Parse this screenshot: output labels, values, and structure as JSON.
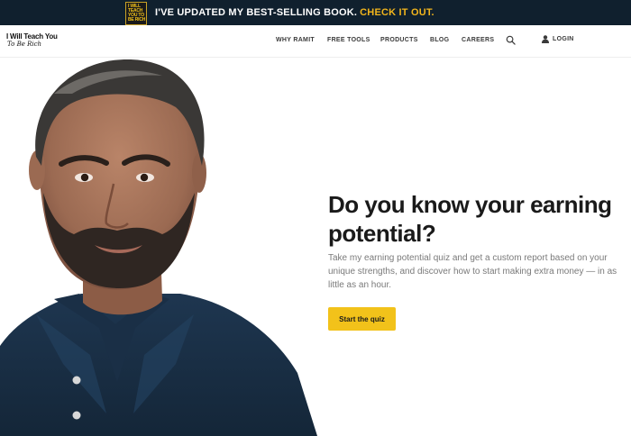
{
  "promo": {
    "book_cover_text": "I Will Teach You To Be Rich",
    "text": "I'VE UPDATED MY BEST-SELLING BOOK.",
    "cta": "CHECK IT OUT.",
    "cta_color": "#f2b51c",
    "background": "#10202e"
  },
  "header": {
    "logo": {
      "line1": "I Will Teach You",
      "line2": "To Be Rich"
    },
    "nav": [
      "WHY RAMIT",
      "FREE TOOLS",
      "PRODUCTS",
      "BLOG",
      "CAREERS"
    ],
    "search_icon": "search-icon",
    "login_icon": "user-icon",
    "login_label": "LOGIN"
  },
  "hero": {
    "photo": "portrait-photo",
    "title": "Do you know your earning potential?",
    "subtitle": "Take my earning potential quiz and get a custom report based on your unique strengths, and discover how to start making extra money — in as little as an hour.",
    "button_label": "Start the quiz",
    "button_color": "#f2c21a"
  }
}
